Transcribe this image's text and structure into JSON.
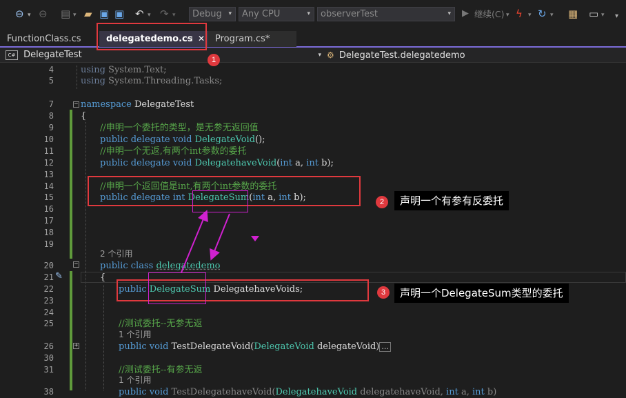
{
  "toolbar": {
    "config": "Debug",
    "platform": "Any CPU",
    "startup_project": "observerTest",
    "continue_label": "继续(C)",
    "icons": [
      "back-icon",
      "forward-icon",
      "new-project-icon",
      "open-icon",
      "save-icon",
      "save-all-icon",
      "undo-icon",
      "redo-icon",
      "start-icon",
      "hot-reload-icon",
      "restart-icon",
      "solution-explorer-icon",
      "layout-icon"
    ]
  },
  "tabs": [
    {
      "label": "FunctionClass.cs"
    },
    {
      "label": "delegatedemo.cs",
      "pin": "⊣",
      "close": "✕"
    },
    {
      "label": "Program.cs*"
    }
  ],
  "nav": {
    "project": "DelegateTest",
    "project_badge": "C#",
    "member": "DelegateTest.delegatedemo"
  },
  "lines": [
    {
      "num": "4",
      "text": "using System.Text;"
    },
    {
      "num": "5",
      "text": "using System.Threading.Tasks;"
    },
    {
      "num": "7",
      "text": "namespace DelegateTest"
    },
    {
      "num": "8",
      "text": "{"
    },
    {
      "num": "9",
      "text": "//申明一个委托的类型，是无参无返回值"
    },
    {
      "num": "10",
      "text": "public delegate void DelegateVoid();"
    },
    {
      "num": "11",
      "text": "//申明一个无返,有两个int参数的委托"
    },
    {
      "num": "12",
      "text": "public delegate void DelegatehaveVoid(int a, int b);"
    },
    {
      "num": "13",
      "text": ""
    },
    {
      "num": "14",
      "text": "//申明一个返回值是int,有两个int参数的委托"
    },
    {
      "num": "15",
      "text": "public delegate int DelegateSum(int a, int b);"
    },
    {
      "num": "16",
      "text": ""
    },
    {
      "num": "17",
      "text": ""
    },
    {
      "num": "18",
      "text": ""
    },
    {
      "num": "19",
      "text": ""
    },
    {
      "num": "20",
      "text": "public class delegatedemo"
    },
    {
      "num": "21",
      "text": "{"
    },
    {
      "num": "22",
      "text": "public DelegateSum DelegatehaveVoids;"
    },
    {
      "num": "23",
      "text": ""
    },
    {
      "num": "24",
      "text": ""
    },
    {
      "num": "25",
      "text": "//测试委托--无参无返"
    },
    {
      "num": "26",
      "text": "public void TestDelegateVoid(DelegateVoid delegateVoid)"
    },
    {
      "num": "30",
      "text": ""
    },
    {
      "num": "31",
      "text": "//测试委托--有参无返"
    }
  ],
  "codelens": {
    "class_refs": "2 个引用",
    "method_refs_1": "1 个引用",
    "method_refs_2": "1 个引用"
  },
  "collapsed_ellipsis": "...",
  "annotations": [
    {
      "number": "1"
    },
    {
      "number": "2",
      "text": "声明一个有参有反委托"
    },
    {
      "number": "3",
      "text": "声明一个DelegateSum类型的委托"
    }
  ],
  "colors": {
    "accent": "#7b6cd9",
    "annotation_red": "#e0393e",
    "arrow_magenta": "#d021d0",
    "change_bar": "#5f9a3b",
    "keyword": "#569cd6",
    "type": "#4ec9b0",
    "comment": "#57a64a"
  }
}
